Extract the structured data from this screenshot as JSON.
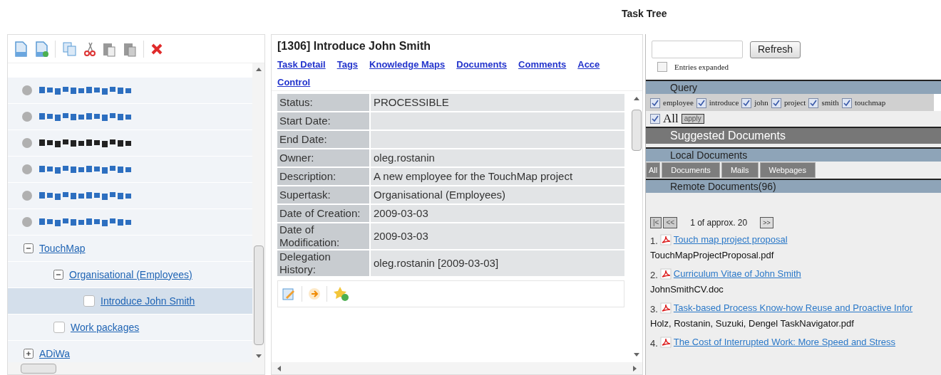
{
  "title": "Task Tree",
  "tree": {
    "items": [
      {
        "kind": "obscured",
        "color": "#2d6fc0"
      },
      {
        "kind": "obscured",
        "color": "#2d6fc0"
      },
      {
        "kind": "obscured",
        "color": "#222222"
      },
      {
        "kind": "obscured",
        "color": "#2d6fc0"
      },
      {
        "kind": "obscured",
        "color": "#2d6fc0"
      },
      {
        "kind": "obscured",
        "color": "#2d6fc0"
      },
      {
        "kind": "node",
        "label": "TouchMap",
        "expanded": true,
        "selected": false,
        "children": [
          {
            "kind": "node",
            "label": "Organisational (Employees)",
            "expanded": true,
            "selected": false,
            "children": [
              {
                "kind": "leaf",
                "label": "Introduce John Smith",
                "selected": true,
                "checked": false
              }
            ]
          },
          {
            "kind": "leaf",
            "label": "Work packages",
            "selected": false,
            "checked": false
          }
        ]
      },
      {
        "kind": "node",
        "label": "ADiWa",
        "expanded": false,
        "selected": false
      }
    ]
  },
  "task": {
    "heading": "[1306] Introduce John Smith",
    "tabs": [
      "Task Detail",
      "Tags",
      "Knowledge Maps",
      "Documents",
      "Comments",
      "Acce",
      "Control"
    ],
    "fields": [
      {
        "label": "Status:",
        "value": "PROCESSIBLE"
      },
      {
        "label": "Start Date:"
      },
      {
        "label": "End Date:"
      },
      {
        "label": "Owner:",
        "value": "oleg.rostanin"
      },
      {
        "label": "Description:",
        "value": "A new employee for the TouchMap project"
      },
      {
        "label": "Supertask:",
        "value": "Organisational (Employees)"
      },
      {
        "label": "Date of Creation:",
        "value": "2009-03-03"
      },
      {
        "label": "Date of Modification:",
        "value": "2009-03-03"
      },
      {
        "label": "Delegation History:",
        "value": "oleg.rostanin [2009-03-03]"
      }
    ]
  },
  "docs": {
    "refresh": "Refresh",
    "entries_expanded": {
      "label": "Entries expanded",
      "checked": false
    },
    "query_header": "Query",
    "terms": [
      {
        "label": "employee",
        "checked": true
      },
      {
        "label": "introduce",
        "checked": true
      },
      {
        "label": "john",
        "checked": true
      },
      {
        "label": "project",
        "checked": true
      },
      {
        "label": "smith",
        "checked": true
      },
      {
        "label": "touchmap",
        "checked": true
      }
    ],
    "all": {
      "label": "All",
      "checked": true
    },
    "apply": "apply",
    "suggested_header": "Suggested Documents",
    "local_header": "Local Documents",
    "filters": [
      "All",
      "Documents",
      "Mails",
      "Webpages"
    ],
    "remote_header": "Remote Documents(96)",
    "pager": {
      "first": "|<",
      "prev": "<<",
      "status": "1 of approx. 20",
      "next": ">>"
    },
    "results": [
      {
        "number": "1.",
        "title": "Touch map project proposal",
        "file": "TouchMapProjectProposal.pdf"
      },
      {
        "number": "2.",
        "title": "Curriculum Vitae of John Smith",
        "file": "JohnSmithCV.doc"
      },
      {
        "number": "3.",
        "title": "Task-based Process Know-how Reuse and Proactive Infor",
        "file": "Holz, Rostanin, Suzuki, Dengel TaskNavigator.pdf"
      },
      {
        "number": "4.",
        "title": "The Cost of Interrupted Work: More Speed and Stress"
      }
    ]
  }
}
